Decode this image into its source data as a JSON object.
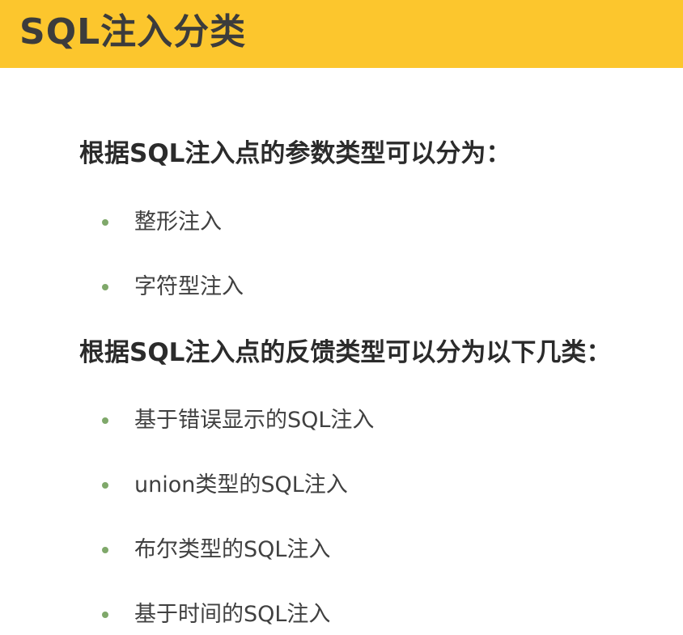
{
  "slide": {
    "title": "SQL注入分类",
    "section_param": {
      "heading": "根据SQL注入点的参数类型可以分为：",
      "items": [
        "整形注入",
        "字符型注入"
      ]
    },
    "section_feedback": {
      "heading": "根据SQL注入点的反馈类型可以分为以下几类：",
      "items": [
        "基于错误显示的SQL注入",
        "union类型的SQL注入",
        "布尔类型的SQL注入",
        "基于时间的SQL注入"
      ]
    }
  },
  "colors": {
    "title_bar": "#fcc62d",
    "title_text": "#3c3c3c",
    "heading_text": "#2b2b2b",
    "bullet": "#7fa86a",
    "item_text": "#404040"
  }
}
